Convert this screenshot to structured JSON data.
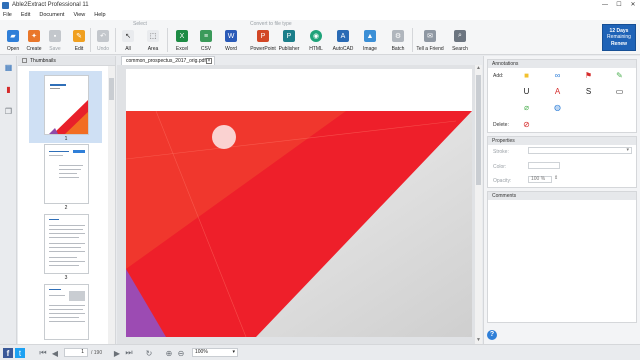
{
  "window": {
    "title": "Able2Extract Professional 11",
    "min": "—",
    "max": "☐",
    "close": "✕"
  },
  "menu": [
    "File",
    "Edit",
    "Document",
    "View",
    "Help"
  ],
  "ribbon": {
    "group_select": "Select",
    "group_convert": "Convert to file type",
    "buttons": {
      "open": "Open",
      "create": "Create",
      "save": "Save",
      "edit": "Edit",
      "undo": "Undo",
      "all": "All",
      "area": "Area",
      "excel": "Excel",
      "csv": "CSV",
      "word": "Word",
      "powerpoint": "PowerPoint",
      "publisher": "Publisher",
      "html": "HTML",
      "autocad": "AutoCAD",
      "image": "Image",
      "batch": "Batch",
      "tellafriend": "Tell a Friend",
      "search": "Search"
    },
    "promo": {
      "days": "12 Days",
      "remaining": "Remaining",
      "renew": "Renew"
    }
  },
  "thumbnails": {
    "title": "Thumbnails",
    "pages": [
      "1",
      "2",
      "3"
    ]
  },
  "document": {
    "tab_name": "common_prospectus_2017_orig.pdf"
  },
  "annotations": {
    "title": "Annotations",
    "add_label": "Add:",
    "delete_label": "Delete:"
  },
  "properties": {
    "title": "Properties",
    "stroke_label": "Stroke:",
    "color_label": "Color:",
    "opacity_label": "Opacity:",
    "opacity_value": "100 %"
  },
  "comments": {
    "title": "Comments"
  },
  "status": {
    "page_value": "1",
    "page_total": "/ 190",
    "zoom_value": "100%"
  },
  "colors": {
    "accent": "#1f63b7",
    "doc_red": "#e8202a",
    "excel": "#1e8c45",
    "word": "#2b5bb8",
    "ppt": "#d24726"
  }
}
